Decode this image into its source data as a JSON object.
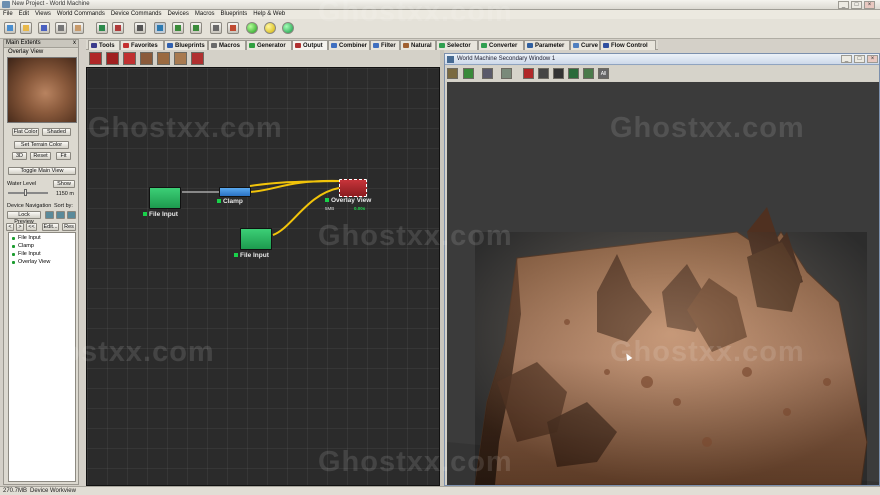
{
  "window": {
    "title": "New Project - World Machine",
    "controls": [
      "_",
      "□",
      "×"
    ]
  },
  "menu": [
    "File",
    "Edit",
    "Views",
    "World Commands",
    "Device Commands",
    "Devices",
    "Macros",
    "Blueprints",
    "Help & Web"
  ],
  "toolbar": {
    "icons": [
      "new-file-icon",
      "open-folder-icon",
      "save-icon",
      "print-icon",
      "workflow-icon",
      "hand-icon",
      "layout-icon",
      "layout-view-icon",
      "grid-icon",
      "terrain-icon",
      "tiled-icon",
      "settings-icon",
      "build-icon",
      "build-tiles-icon",
      "build-selected-icon"
    ]
  },
  "left_panel": {
    "header": "Main Extents",
    "close": "x",
    "preview_title": "Overlay View",
    "buttons": {
      "flat_color": "Flat Color",
      "shaded": "Shaded",
      "set_terrain_color": "Set Terrain Color",
      "three_d": "3D",
      "reset": "Reset",
      "fit": "Fit",
      "toggle_main_view": "Toggle Main View",
      "show": "Show",
      "lock_preview": "Lock Preview",
      "edit": "Edit...",
      "res": "Res"
    },
    "water_level_label": "Water Level",
    "water_level_value": "1150 m",
    "device_navigation_label": "Device Navigation",
    "sort_by_label": "Sort by:",
    "nav_arrows": [
      "<",
      ">",
      "<<"
    ],
    "tree_items": [
      "File Input",
      "Clamp",
      "File Input",
      "Overlay View"
    ]
  },
  "tabs": [
    {
      "label": "Tools",
      "color": "#3c3c8c"
    },
    {
      "label": "Favorites",
      "color": "#c43030"
    },
    {
      "label": "Blueprints",
      "color": "#3060b0"
    },
    {
      "label": "Macros",
      "color": "#6a6a6a"
    },
    {
      "label": "Generator",
      "color": "#30a040"
    },
    {
      "label": "Output",
      "color": "#b03030"
    },
    {
      "label": "Combiner",
      "color": "#4070c0"
    },
    {
      "label": "Filter",
      "color": "#4070c0"
    },
    {
      "label": "Natural",
      "color": "#a06030"
    },
    {
      "label": "Selector",
      "color": "#30a050"
    },
    {
      "label": "Converter",
      "color": "#30a050"
    },
    {
      "label": "Parameter",
      "color": "#3060a0"
    },
    {
      "label": "Curve",
      "color": "#5080c0"
    },
    {
      "label": "Flow Control",
      "color": "#3050a0"
    }
  ],
  "active_tab": "Output",
  "device_icons": [
    "output-device-icon",
    "save-device-icon",
    "overlay-device-icon",
    "splat-device-icon",
    "height-output-icon",
    "mesh-output-icon",
    "export-device-icon"
  ],
  "graph": {
    "nodes": [
      {
        "id": "file1",
        "label": "File Input",
        "color": "green"
      },
      {
        "id": "clamp",
        "label": "Clamp",
        "color": "blue"
      },
      {
        "id": "overlay",
        "label": "Overlay View",
        "color": "red",
        "sub_left": "5MB",
        "sub_right": "0.00s"
      },
      {
        "id": "file2",
        "label": "File Input",
        "color": "green"
      }
    ]
  },
  "secondary_window": {
    "title": "World Machine Secondary Window 1",
    "controls": [
      "_",
      "□",
      "×"
    ],
    "toolbar_icons": [
      "camera-icon",
      "grid-view-icon",
      "shaded-view-icon",
      "terrain-view-icon",
      "render-icon",
      "hd-icon",
      "lock-icon",
      "draw-icon",
      "settings-icon",
      "all-view-icon"
    ],
    "all_label": "All"
  },
  "watermark": "Ghostxx.com",
  "status": {
    "memory": "270.7MB",
    "mode": "Device Workview"
  }
}
